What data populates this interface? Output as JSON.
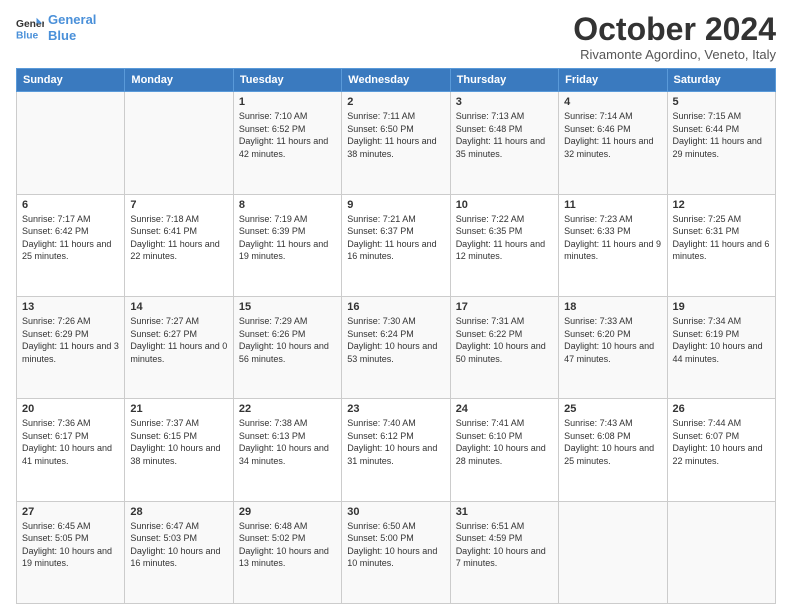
{
  "logo": {
    "line1": "General",
    "line2": "Blue"
  },
  "header": {
    "title": "October 2024",
    "subtitle": "Rivamonte Agordino, Veneto, Italy"
  },
  "days_of_week": [
    "Sunday",
    "Monday",
    "Tuesday",
    "Wednesday",
    "Thursday",
    "Friday",
    "Saturday"
  ],
  "weeks": [
    [
      {
        "day": "",
        "info": ""
      },
      {
        "day": "",
        "info": ""
      },
      {
        "day": "1",
        "info": "Sunrise: 7:10 AM\nSunset: 6:52 PM\nDaylight: 11 hours and 42 minutes."
      },
      {
        "day": "2",
        "info": "Sunrise: 7:11 AM\nSunset: 6:50 PM\nDaylight: 11 hours and 38 minutes."
      },
      {
        "day": "3",
        "info": "Sunrise: 7:13 AM\nSunset: 6:48 PM\nDaylight: 11 hours and 35 minutes."
      },
      {
        "day": "4",
        "info": "Sunrise: 7:14 AM\nSunset: 6:46 PM\nDaylight: 11 hours and 32 minutes."
      },
      {
        "day": "5",
        "info": "Sunrise: 7:15 AM\nSunset: 6:44 PM\nDaylight: 11 hours and 29 minutes."
      }
    ],
    [
      {
        "day": "6",
        "info": "Sunrise: 7:17 AM\nSunset: 6:42 PM\nDaylight: 11 hours and 25 minutes."
      },
      {
        "day": "7",
        "info": "Sunrise: 7:18 AM\nSunset: 6:41 PM\nDaylight: 11 hours and 22 minutes."
      },
      {
        "day": "8",
        "info": "Sunrise: 7:19 AM\nSunset: 6:39 PM\nDaylight: 11 hours and 19 minutes."
      },
      {
        "day": "9",
        "info": "Sunrise: 7:21 AM\nSunset: 6:37 PM\nDaylight: 11 hours and 16 minutes."
      },
      {
        "day": "10",
        "info": "Sunrise: 7:22 AM\nSunset: 6:35 PM\nDaylight: 11 hours and 12 minutes."
      },
      {
        "day": "11",
        "info": "Sunrise: 7:23 AM\nSunset: 6:33 PM\nDaylight: 11 hours and 9 minutes."
      },
      {
        "day": "12",
        "info": "Sunrise: 7:25 AM\nSunset: 6:31 PM\nDaylight: 11 hours and 6 minutes."
      }
    ],
    [
      {
        "day": "13",
        "info": "Sunrise: 7:26 AM\nSunset: 6:29 PM\nDaylight: 11 hours and 3 minutes."
      },
      {
        "day": "14",
        "info": "Sunrise: 7:27 AM\nSunset: 6:27 PM\nDaylight: 11 hours and 0 minutes."
      },
      {
        "day": "15",
        "info": "Sunrise: 7:29 AM\nSunset: 6:26 PM\nDaylight: 10 hours and 56 minutes."
      },
      {
        "day": "16",
        "info": "Sunrise: 7:30 AM\nSunset: 6:24 PM\nDaylight: 10 hours and 53 minutes."
      },
      {
        "day": "17",
        "info": "Sunrise: 7:31 AM\nSunset: 6:22 PM\nDaylight: 10 hours and 50 minutes."
      },
      {
        "day": "18",
        "info": "Sunrise: 7:33 AM\nSunset: 6:20 PM\nDaylight: 10 hours and 47 minutes."
      },
      {
        "day": "19",
        "info": "Sunrise: 7:34 AM\nSunset: 6:19 PM\nDaylight: 10 hours and 44 minutes."
      }
    ],
    [
      {
        "day": "20",
        "info": "Sunrise: 7:36 AM\nSunset: 6:17 PM\nDaylight: 10 hours and 41 minutes."
      },
      {
        "day": "21",
        "info": "Sunrise: 7:37 AM\nSunset: 6:15 PM\nDaylight: 10 hours and 38 minutes."
      },
      {
        "day": "22",
        "info": "Sunrise: 7:38 AM\nSunset: 6:13 PM\nDaylight: 10 hours and 34 minutes."
      },
      {
        "day": "23",
        "info": "Sunrise: 7:40 AM\nSunset: 6:12 PM\nDaylight: 10 hours and 31 minutes."
      },
      {
        "day": "24",
        "info": "Sunrise: 7:41 AM\nSunset: 6:10 PM\nDaylight: 10 hours and 28 minutes."
      },
      {
        "day": "25",
        "info": "Sunrise: 7:43 AM\nSunset: 6:08 PM\nDaylight: 10 hours and 25 minutes."
      },
      {
        "day": "26",
        "info": "Sunrise: 7:44 AM\nSunset: 6:07 PM\nDaylight: 10 hours and 22 minutes."
      }
    ],
    [
      {
        "day": "27",
        "info": "Sunrise: 6:45 AM\nSunset: 5:05 PM\nDaylight: 10 hours and 19 minutes."
      },
      {
        "day": "28",
        "info": "Sunrise: 6:47 AM\nSunset: 5:03 PM\nDaylight: 10 hours and 16 minutes."
      },
      {
        "day": "29",
        "info": "Sunrise: 6:48 AM\nSunset: 5:02 PM\nDaylight: 10 hours and 13 minutes."
      },
      {
        "day": "30",
        "info": "Sunrise: 6:50 AM\nSunset: 5:00 PM\nDaylight: 10 hours and 10 minutes."
      },
      {
        "day": "31",
        "info": "Sunrise: 6:51 AM\nSunset: 4:59 PM\nDaylight: 10 hours and 7 minutes."
      },
      {
        "day": "",
        "info": ""
      },
      {
        "day": "",
        "info": ""
      }
    ]
  ]
}
